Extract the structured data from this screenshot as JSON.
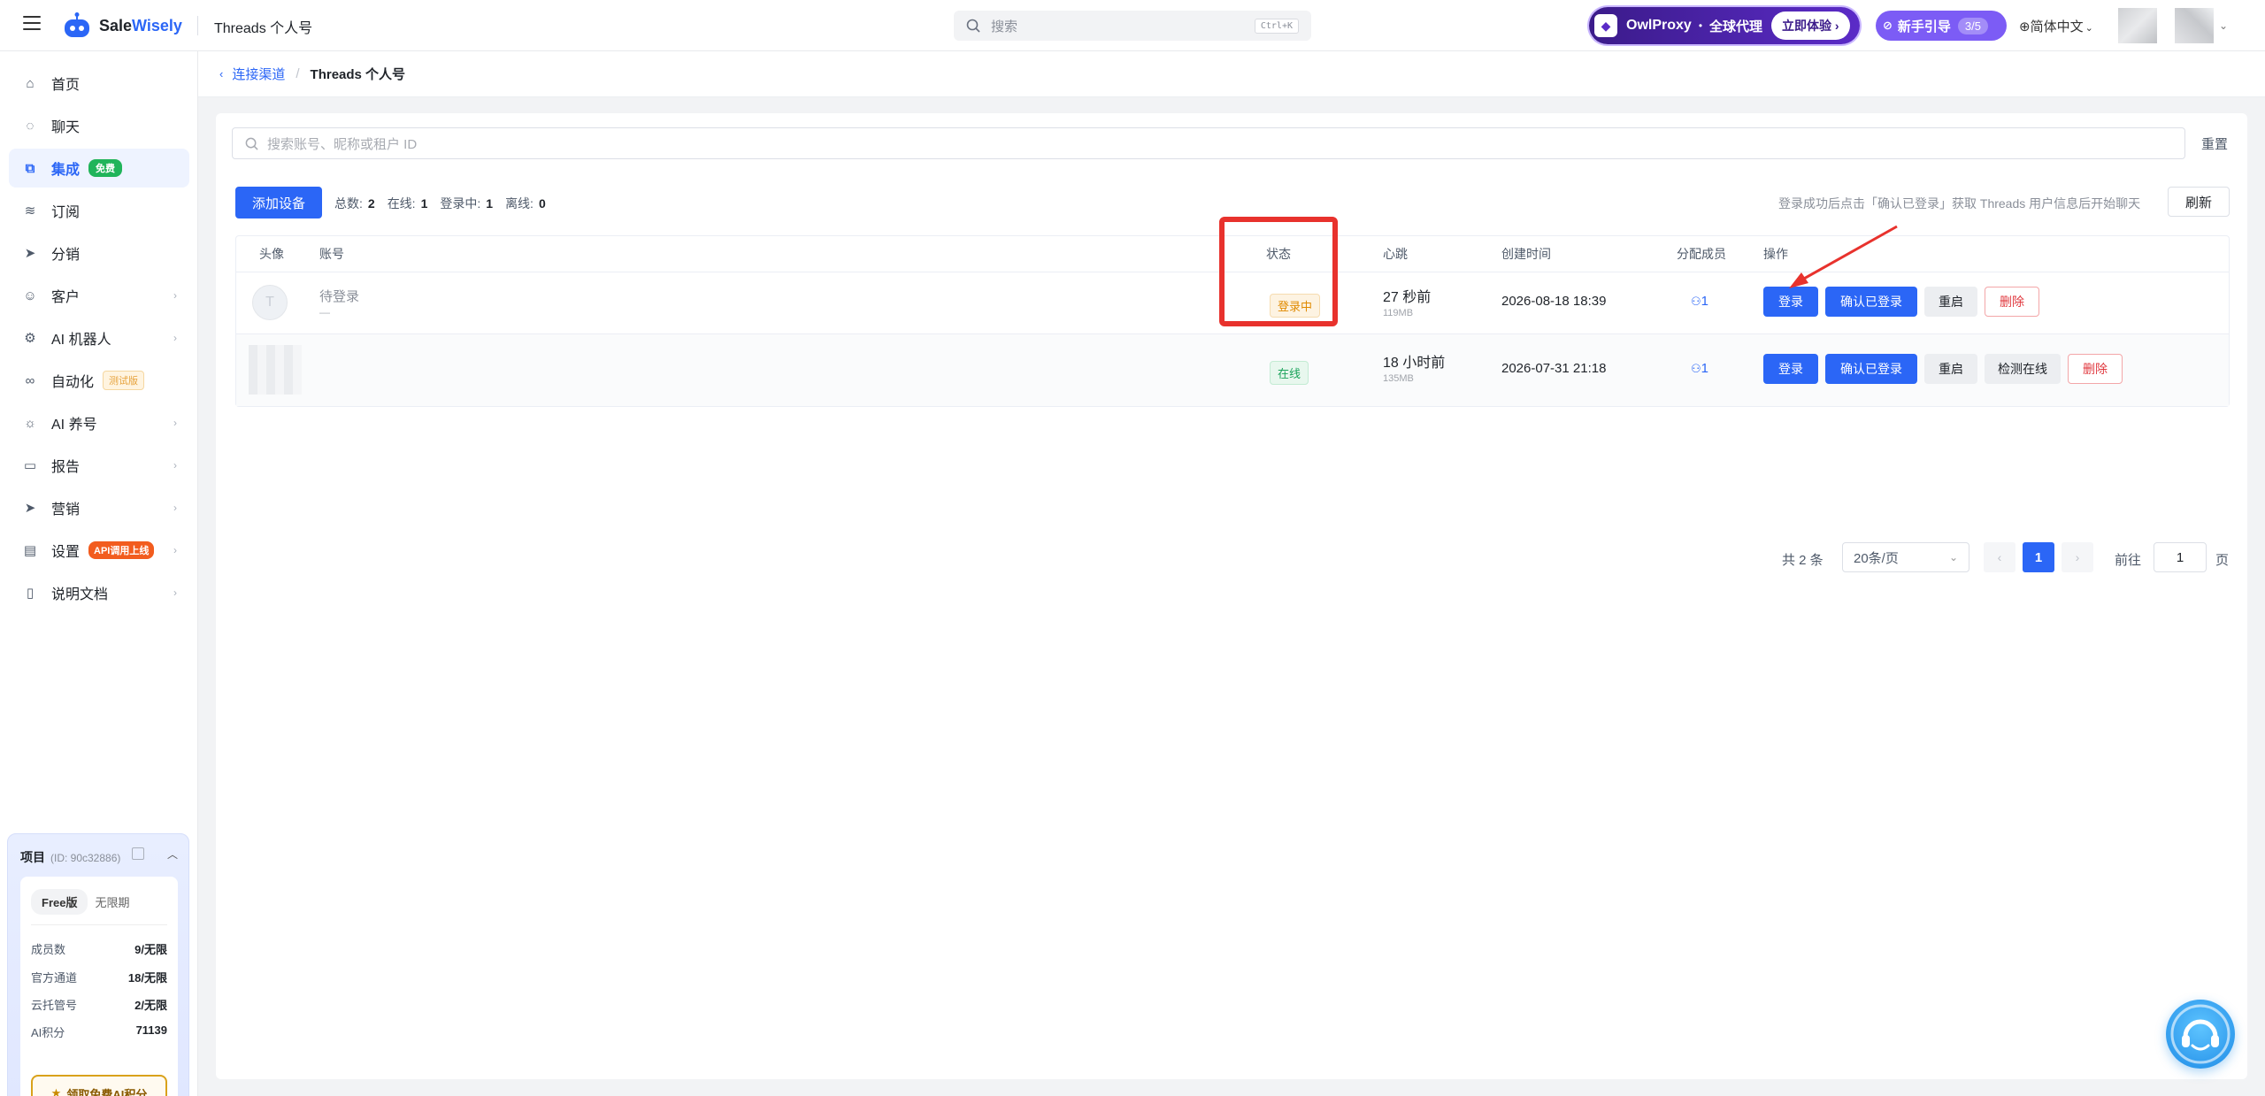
{
  "header": {
    "brand_plain": "Sale",
    "brand_bold": "Wisely",
    "page_title": "Threads 个人号",
    "search_placeholder": "搜索",
    "search_shortcut": "Ctrl+K",
    "promo": {
      "name": "OwlProxy",
      "dot": "•",
      "tagline": "全球代理",
      "cta": "立即体验 ›"
    },
    "guide": {
      "label": "新手引导",
      "progress": "3/5"
    },
    "language": "简体中文"
  },
  "sidebar": {
    "items": [
      {
        "label": "首页",
        "icon": "home-icon"
      },
      {
        "label": "聊天",
        "icon": "chat-icon"
      },
      {
        "label": "集成",
        "icon": "integration-icon",
        "badge": "免费",
        "active": true
      },
      {
        "label": "订阅",
        "icon": "database-icon"
      },
      {
        "label": "分销",
        "icon": "send-icon"
      },
      {
        "label": "客户",
        "icon": "user-icon"
      },
      {
        "label": "AI 机器人",
        "icon": "chip-icon"
      },
      {
        "label": "自动化",
        "icon": "automation-icon",
        "badge": "测试版"
      },
      {
        "label": "AI 养号",
        "icon": "sun-icon"
      },
      {
        "label": "报告",
        "icon": "report-icon"
      },
      {
        "label": "营销",
        "icon": "megaphone-icon"
      },
      {
        "label": "设置",
        "icon": "settings-icon",
        "badge": "API调用上线"
      },
      {
        "label": "说明文档",
        "icon": "doc-icon"
      }
    ],
    "project": {
      "title": "项目",
      "id": "(ID: 90c32886)",
      "plan": "Free版",
      "term": "无限期",
      "stats": [
        {
          "k": "成员数",
          "v": "9/无限"
        },
        {
          "k": "官方通道",
          "v": "18/无限"
        },
        {
          "k": "云托管号",
          "v": "2/无限"
        },
        {
          "k": "AI积分",
          "v": "71139"
        }
      ],
      "ai_button": "领取免费AI积分"
    }
  },
  "breadcrumb": {
    "parent": "连接渠道",
    "separator": "/",
    "current": "Threads 个人号"
  },
  "toolbar": {
    "search_placeholder": "搜索账号、昵称或租户 ID",
    "reset": "重置",
    "add_device": "添加设备",
    "summary": [
      {
        "k": "总数:",
        "v": "2"
      },
      {
        "k": "在线:",
        "v": "1"
      },
      {
        "k": "登录中:",
        "v": "1"
      },
      {
        "k": "离线:",
        "v": "0"
      }
    ],
    "hint": "登录成功后点击「确认已登录」获取 Threads 用户信息后开始聊天",
    "refresh": "刷新"
  },
  "table": {
    "headers": [
      "头像",
      "账号",
      "状态",
      "心跳",
      "创建时间",
      "分配成员",
      "操作"
    ],
    "rows": [
      {
        "avatar_letter": "T",
        "account": "待登录",
        "account_sub": "—",
        "status": "登录中",
        "heartbeat": "27 秒前",
        "memory": "119MB",
        "created": "2026-08-18 18:39",
        "members": "1",
        "actions": [
          "登录",
          "确认已登录",
          "重启",
          "删除"
        ]
      },
      {
        "avatar_letter": "",
        "account": "",
        "account_sub": "",
        "status": "在线",
        "heartbeat": "18 小时前",
        "memory": "135MB",
        "created": "2026-07-31 21:18",
        "members": "1",
        "actions": [
          "登录",
          "确认已登录",
          "重启",
          "检测在线",
          "删除"
        ]
      }
    ]
  },
  "pagination": {
    "total": "共 2 条",
    "page_size": "20条/页",
    "current": "1",
    "goto_label": "前往",
    "goto_value": "1",
    "page_suffix": "页"
  },
  "colors": {
    "primary": "#2b66f6",
    "highlight": "#e8322d",
    "pending": "#e08a00",
    "online": "#1aa35a",
    "danger": "#e0383e"
  }
}
